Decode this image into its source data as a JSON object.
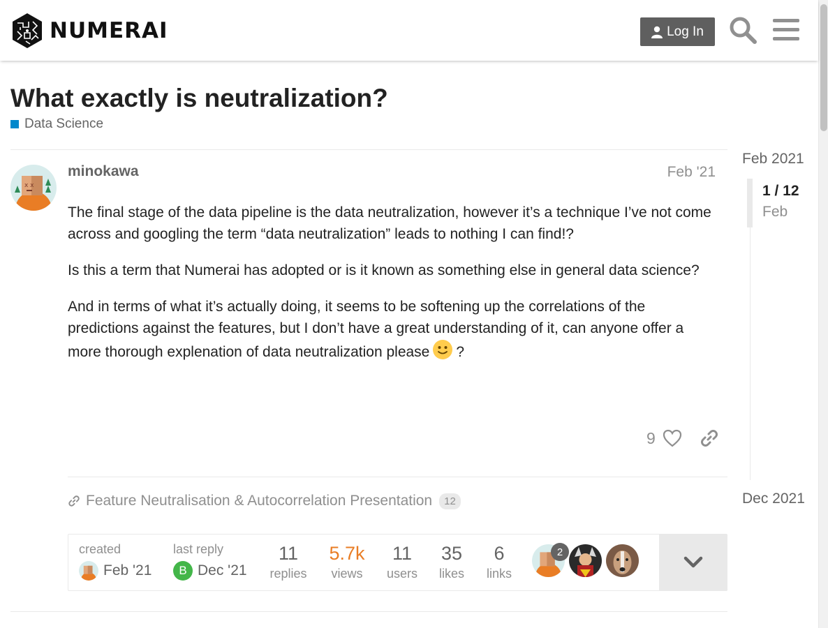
{
  "header": {
    "brand": "NUMERAI",
    "login_label": "Log In",
    "icons": [
      "user-icon",
      "search-icon",
      "hamburger-menu-icon"
    ]
  },
  "topic": {
    "title": "What exactly is neutralization?",
    "category": "Data Science",
    "category_color": "#0088cc"
  },
  "post": {
    "username": "minokawa",
    "date": "Feb '21",
    "paragraphs": [
      "The final stage of the data pipeline is the data neutralization, however it’s a technique I’ve not come across and googling the term “data neutralization” leads to nothing I can find!?",
      "Is this a term that Numerai has adopted or is it known as something else in general data science?",
      "And in terms of what it’s actually doing, it seems to be softening up the correlations of the predictions against the features, but I don’t have a great understanding of it, can anyone offer a more thorough explenation of data neutralization please",
      "?"
    ],
    "emoji": "slight-smile-emoji",
    "likes": "9"
  },
  "linked_topic": {
    "title": "Feature Neutralisation & Autocorrelation Presentation",
    "clicks": "12"
  },
  "topic_map": {
    "created_label": "created",
    "created_date": "Feb '21",
    "last_reply_label": "last reply",
    "last_reply_date": "Dec '21",
    "last_reply_avatar_letter": "B",
    "stats": [
      {
        "num": "11",
        "label": "replies"
      },
      {
        "num": "5.7k",
        "label": "views"
      },
      {
        "num": "11",
        "label": "users"
      },
      {
        "num": "35",
        "label": "likes"
      },
      {
        "num": "6",
        "label": "links"
      }
    ],
    "top_poster_count": "2"
  },
  "timeline": {
    "start": "Feb 2021",
    "position": "1 / 12",
    "position_date": "Feb",
    "end": "Dec 2021"
  },
  "colors": {
    "login_bg": "#5f5f5f",
    "views_highlight": "#e97d25",
    "muted_text": "#8f8f8f"
  }
}
